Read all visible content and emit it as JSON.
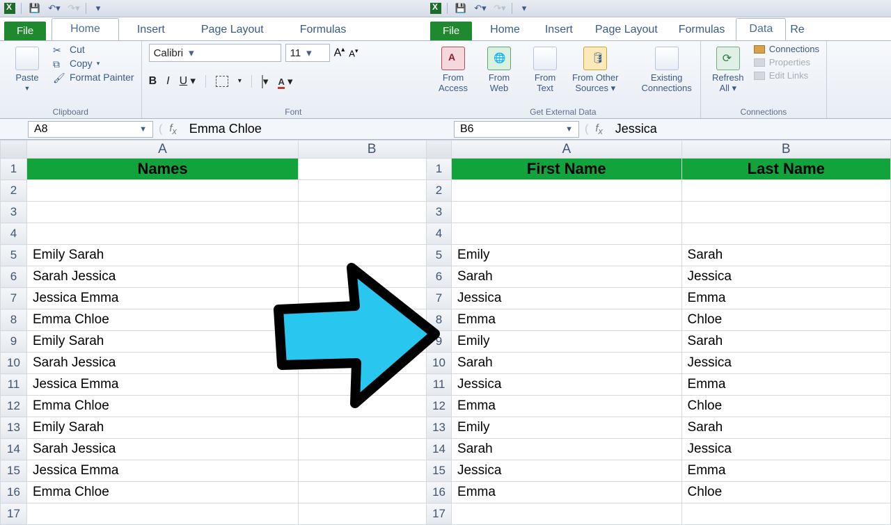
{
  "left": {
    "tabs": {
      "file": "File",
      "home": "Home",
      "insert": "Insert",
      "page_layout": "Page Layout",
      "formulas": "Formulas"
    },
    "clipboard": {
      "paste": "Paste",
      "cut": "Cut",
      "copy": "Copy",
      "format_painter": "Format Painter",
      "group": "Clipboard"
    },
    "font": {
      "name": "Calibri",
      "size": "11",
      "group": "Font"
    },
    "namebox": "A8",
    "formula": "Emma Chloe",
    "col_a": "A",
    "col_b": "B",
    "header_a": "Names",
    "rows": [
      {
        "n": "1"
      },
      {
        "n": "2"
      },
      {
        "n": "3"
      },
      {
        "n": "4"
      },
      {
        "n": "5",
        "a": "Emily Sarah"
      },
      {
        "n": "6",
        "a": "Sarah Jessica"
      },
      {
        "n": "7",
        "a": "Jessica Emma"
      },
      {
        "n": "8",
        "a": "Emma Chloe"
      },
      {
        "n": "9",
        "a": "Emily Sarah"
      },
      {
        "n": "10",
        "a": "Sarah Jessica"
      },
      {
        "n": "11",
        "a": "Jessica Emma"
      },
      {
        "n": "12",
        "a": "Emma Chloe"
      },
      {
        "n": "13",
        "a": "Emily Sarah"
      },
      {
        "n": "14",
        "a": "Sarah Jessica"
      },
      {
        "n": "15",
        "a": "Jessica Emma"
      },
      {
        "n": "16",
        "a": "Emma Chloe"
      },
      {
        "n": "17"
      }
    ]
  },
  "right": {
    "tabs": {
      "file": "File",
      "home": "Home",
      "insert": "Insert",
      "page_layout": "Page Layout",
      "formulas": "Formulas",
      "data": "Data",
      "re": "Re"
    },
    "ext": {
      "access": "From\nAccess",
      "web": "From\nWeb",
      "text": "From\nText",
      "other": "From Other\nSources",
      "existing": "Existing\nConnections",
      "group": "Get External Data"
    },
    "refresh": "Refresh\nAll",
    "conn": {
      "connections": "Connections",
      "properties": "Properties",
      "edit": "Edit Links",
      "group": "Connections"
    },
    "namebox": "B6",
    "formula": "Jessica",
    "col_a": "A",
    "col_b": "B",
    "header_a": "First Name",
    "header_b": "Last Name",
    "rows": [
      {
        "n": "1"
      },
      {
        "n": "2"
      },
      {
        "n": "3"
      },
      {
        "n": "4"
      },
      {
        "n": "5",
        "a": "Emily",
        "b": "Sarah"
      },
      {
        "n": "6",
        "a": "Sarah",
        "b": "Jessica"
      },
      {
        "n": "7",
        "a": "Jessica",
        "b": "Emma"
      },
      {
        "n": "8",
        "a": "Emma",
        "b": "Chloe"
      },
      {
        "n": "9",
        "a": "Emily",
        "b": "Sarah"
      },
      {
        "n": "10",
        "a": "Sarah",
        "b": "Jessica"
      },
      {
        "n": "11",
        "a": "Jessica",
        "b": "Emma"
      },
      {
        "n": "12",
        "a": "Emma",
        "b": "Chloe"
      },
      {
        "n": "13",
        "a": "Emily",
        "b": "Sarah"
      },
      {
        "n": "14",
        "a": "Sarah",
        "b": "Jessica"
      },
      {
        "n": "15",
        "a": "Jessica",
        "b": "Emma"
      },
      {
        "n": "16",
        "a": "Emma",
        "b": "Chloe"
      },
      {
        "n": "17"
      }
    ]
  }
}
